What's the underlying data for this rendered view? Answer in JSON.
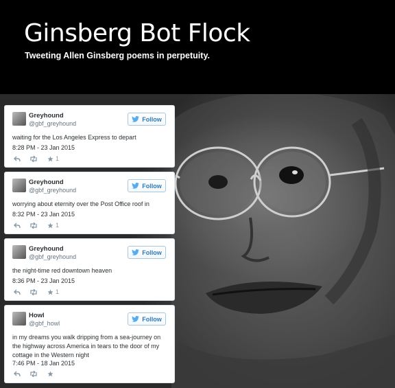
{
  "site": {
    "title": "Ginsberg Bot Flock",
    "subtitle": "Tweeting Allen Ginsberg poems in perpetuity."
  },
  "tweets": [
    {
      "name": "Greyhound",
      "handle": "@gbf_greyhound",
      "follow": "Follow",
      "text": "waiting for the Los Angeles Express to depart",
      "time": "8:28 PM - 23 Jan 2015",
      "favorites": "1"
    },
    {
      "name": "Greyhound",
      "handle": "@gbf_greyhound",
      "follow": "Follow",
      "text": "worrying about eternity over the Post Office roof in",
      "time": "8:32 PM - 23 Jan 2015",
      "favorites": "1"
    },
    {
      "name": "Greyhound",
      "handle": "@gbf_greyhound",
      "follow": "Follow",
      "text": "the night-time red downtown heaven",
      "time": "8:36 PM - 23 Jan 2015",
      "favorites": "1"
    },
    {
      "name": "Howl",
      "handle": "@gbf_howl",
      "follow": "Follow",
      "text": "in my dreams you walk dripping from a sea-journey on the highway across America in tears to the door of my cottage in the Western night",
      "time": "7:46 PM - 18 Jan 2015",
      "favorites": ""
    }
  ],
  "icons": {
    "reply": "reply-icon",
    "retweet": "retweet-icon",
    "favorite": "star-icon",
    "bird": "twitter-bird-icon"
  }
}
